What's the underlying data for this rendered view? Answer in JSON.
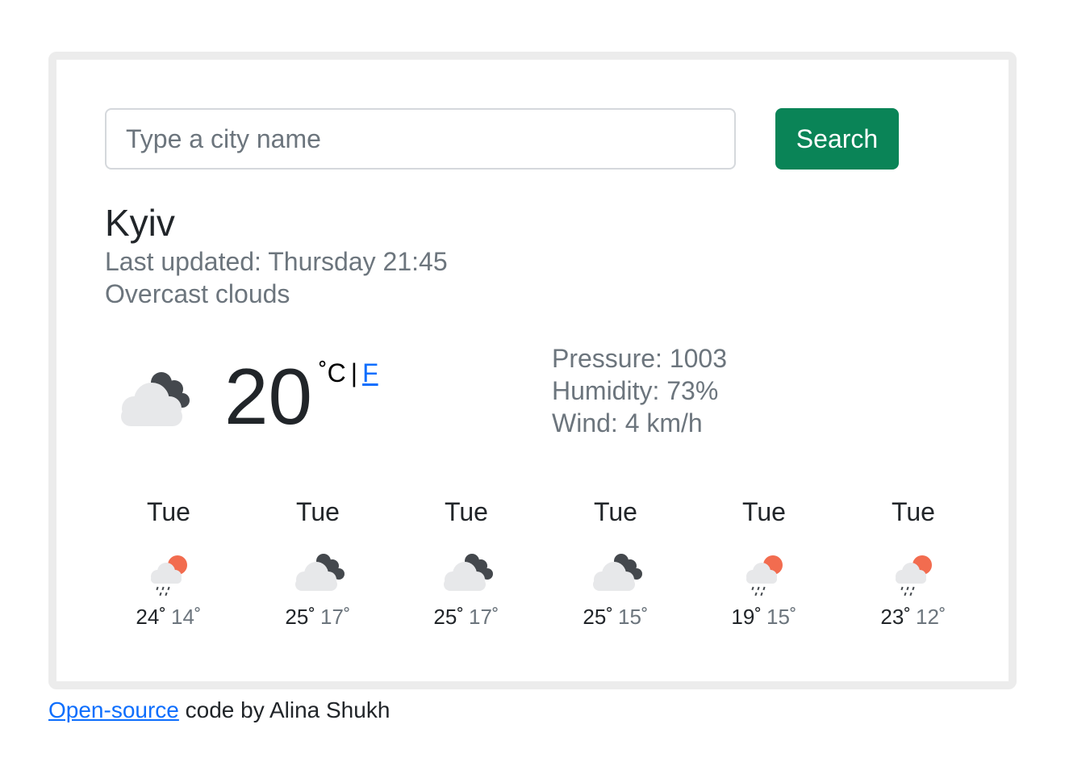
{
  "search": {
    "placeholder": "Type a city name",
    "button_label": "Search"
  },
  "current": {
    "city": "Kyiv",
    "last_updated": "Last updated: Thursday 21:45",
    "description": "Overcast clouds",
    "icon": "overcast-clouds-icon",
    "temperature": "20",
    "unit_celsius": "˚C",
    "unit_separator": "|",
    "unit_fahrenheit": "F",
    "pressure": "Pressure: 1003",
    "humidity": "Humidity: 73%",
    "wind": "Wind: 4 km/h"
  },
  "forecast": [
    {
      "day": "Tue",
      "icon": "rain-sun-icon",
      "max": "24˚",
      "min": "14˚"
    },
    {
      "day": "Tue",
      "icon": "broken-clouds-icon",
      "max": "25˚",
      "min": "17˚"
    },
    {
      "day": "Tue",
      "icon": "broken-clouds-icon",
      "max": "25˚",
      "min": "17˚"
    },
    {
      "day": "Tue",
      "icon": "broken-clouds-icon",
      "max": "25˚",
      "min": "15˚"
    },
    {
      "day": "Tue",
      "icon": "rain-sun-icon",
      "max": "19˚",
      "min": "15˚"
    },
    {
      "day": "Tue",
      "icon": "rain-sun-icon",
      "max": "23˚",
      "min": "12˚"
    }
  ],
  "footer": {
    "link_text": "Open-source",
    "text": " code by Alina Shukh"
  },
  "colors": {
    "accent": "#0a8457",
    "link": "#0d6efd",
    "sun": "#f26c4f",
    "dark_cloud": "#44484d",
    "light_cloud": "#e7e8ea"
  }
}
